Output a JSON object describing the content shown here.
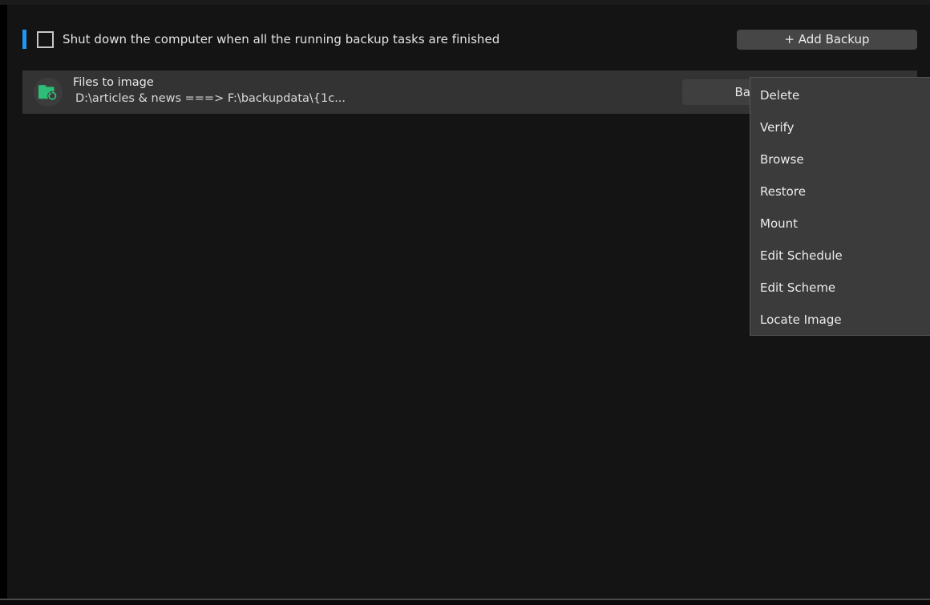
{
  "options": {
    "shutdown_label": "Shut down the computer when all the running backup tasks are finished",
    "shutdown_checked": false,
    "add_backup_label": "+ Add Backup",
    "accent_color": "#2196f3"
  },
  "tasks": [
    {
      "icon": "folder-backup-icon",
      "icon_color": "#2ebd76",
      "title": "Files to image",
      "path": "D:\\articles & news ===> F:\\backupdata\\{1c...",
      "action_label": "Backup"
    }
  ],
  "context_menu": {
    "items": [
      {
        "label": "Delete",
        "name": "menu-item-delete"
      },
      {
        "label": "Verify",
        "name": "menu-item-verify"
      },
      {
        "label": "Browse",
        "name": "menu-item-browse"
      },
      {
        "label": "Restore",
        "name": "menu-item-restore"
      },
      {
        "label": "Mount",
        "name": "menu-item-mount"
      },
      {
        "label": "Edit Schedule",
        "name": "menu-item-edit-schedule"
      },
      {
        "label": "Edit Scheme",
        "name": "menu-item-edit-scheme"
      },
      {
        "label": "Locate Image",
        "name": "menu-item-locate-image"
      }
    ]
  },
  "theme": {
    "background": "#141414",
    "card_background": "#333333",
    "menu_background": "#3b3b3b",
    "button_background": "#464646",
    "text_color": "#e8e8e8"
  }
}
